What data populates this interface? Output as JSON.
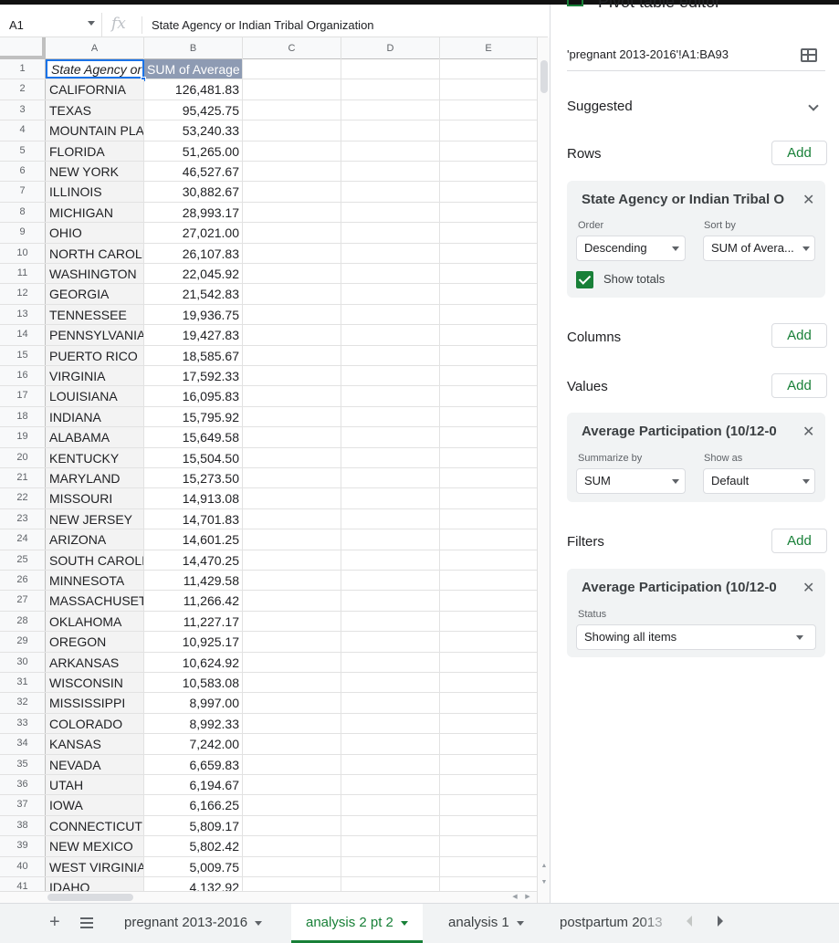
{
  "formula_bar": {
    "name_box": "A1",
    "fx": "fx",
    "content": "State Agency or Indian Tribal Organization"
  },
  "grid": {
    "columns": [
      "A",
      "B",
      "C",
      "D",
      "E"
    ],
    "header_row": {
      "num": "1",
      "a": "State Agency or Indian Tribal Organization",
      "b": "SUM of Average Participation"
    },
    "rows": [
      [
        "2",
        "CALIFORNIA",
        "126,481.83"
      ],
      [
        "3",
        "TEXAS",
        "95,425.75"
      ],
      [
        "4",
        "MOUNTAIN PLAINS",
        "53,240.33"
      ],
      [
        "5",
        "FLORIDA",
        "51,265.00"
      ],
      [
        "6",
        "NEW YORK",
        "46,527.67"
      ],
      [
        "7",
        "ILLINOIS",
        "30,882.67"
      ],
      [
        "8",
        "MICHIGAN",
        "28,993.17"
      ],
      [
        "9",
        "OHIO",
        "27,021.00"
      ],
      [
        "10",
        "NORTH CAROLINA",
        "26,107.83"
      ],
      [
        "11",
        "WASHINGTON",
        "22,045.92"
      ],
      [
        "12",
        "GEORGIA",
        "21,542.83"
      ],
      [
        "13",
        "TENNESSEE",
        "19,936.75"
      ],
      [
        "14",
        "PENNSYLVANIA",
        "19,427.83"
      ],
      [
        "15",
        "PUERTO RICO",
        "18,585.67"
      ],
      [
        "16",
        "VIRGINIA",
        "17,592.33"
      ],
      [
        "17",
        "LOUISIANA",
        "16,095.83"
      ],
      [
        "18",
        "INDIANA",
        "15,795.92"
      ],
      [
        "19",
        "ALABAMA",
        "15,649.58"
      ],
      [
        "20",
        "KENTUCKY",
        "15,504.50"
      ],
      [
        "21",
        "MARYLAND",
        "15,273.50"
      ],
      [
        "22",
        "MISSOURI",
        "14,913.08"
      ],
      [
        "23",
        "NEW JERSEY",
        "14,701.83"
      ],
      [
        "24",
        "ARIZONA",
        "14,601.25"
      ],
      [
        "25",
        "SOUTH CAROLINA",
        "14,470.25"
      ],
      [
        "26",
        "MINNESOTA",
        "11,429.58"
      ],
      [
        "27",
        "MASSACHUSETTS",
        "11,266.42"
      ],
      [
        "28",
        "OKLAHOMA",
        "11,227.17"
      ],
      [
        "29",
        "OREGON",
        "10,925.17"
      ],
      [
        "30",
        "ARKANSAS",
        "10,624.92"
      ],
      [
        "31",
        "WISCONSIN",
        "10,583.08"
      ],
      [
        "32",
        "MISSISSIPPI",
        "8,997.00"
      ],
      [
        "33",
        "COLORADO",
        "8,992.33"
      ],
      [
        "34",
        "KANSAS",
        "7,242.00"
      ],
      [
        "35",
        "NEVADA",
        "6,659.83"
      ],
      [
        "36",
        "UTAH",
        "6,194.67"
      ],
      [
        "37",
        "IOWA",
        "6,166.25"
      ],
      [
        "38",
        "CONNECTICUT",
        "5,809.17"
      ],
      [
        "39",
        "NEW MEXICO",
        "5,802.42"
      ],
      [
        "40",
        "WEST VIRGINIA",
        "5,009.75"
      ],
      [
        "41",
        "IDAHO",
        "4,132.92"
      ]
    ]
  },
  "pivot_editor": {
    "title": "Pivot table editor",
    "range": "'pregnant 2013-2016'!A1:BA93",
    "suggested": "Suggested",
    "add_label": "Add",
    "rows_section": {
      "title": "Rows",
      "field": "State Agency or Indian Tribal O",
      "order_label": "Order",
      "order_value": "Descending",
      "sortby_label": "Sort by",
      "sortby_value": "SUM of Avera...",
      "show_totals": "Show totals"
    },
    "columns_section": {
      "title": "Columns"
    },
    "values_section": {
      "title": "Values",
      "field": "Average Participation (10/12-0",
      "summarize_label": "Summarize by",
      "summarize_value": "SUM",
      "showas_label": "Show as",
      "showas_value": "Default"
    },
    "filters_section": {
      "title": "Filters",
      "field": "Average Participation (10/12-0",
      "status_label": "Status",
      "status_value": "Showing all items"
    }
  },
  "sheet_tabs": {
    "tabs": [
      "pregnant 2013-2016",
      "analysis 2 pt 2",
      "analysis 1",
      "postpartum 2013"
    ],
    "active_index": 1
  },
  "colors": {
    "accent_green": "#188038",
    "selection_blue": "#1a73e8",
    "pivot_header_bg": "#8e9bb3"
  }
}
